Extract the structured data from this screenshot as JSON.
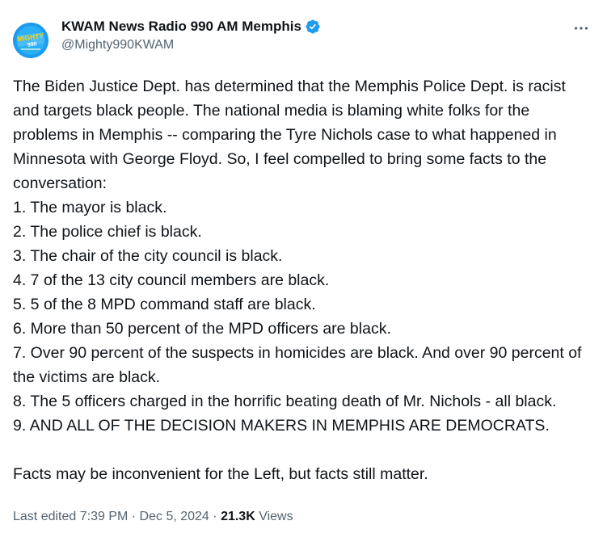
{
  "author": {
    "display_name": "KWAM News Radio 990 AM Memphis",
    "handle": "@Mighty990KWAM",
    "avatar_icon": "station-logo-icon",
    "avatar_text_top": "MIGHTY",
    "avatar_text_bottom": "990",
    "verified": true,
    "verified_color": "#1d9bf0"
  },
  "tweet": {
    "intro": "The Biden Justice Dept. has determined that the Memphis Police Dept. is racist and targets black people. The national media is blaming white folks for the problems in Memphis -- comparing the Tyre Nichols case to what happened in Minnesota with George Floyd. So, I feel compelled to bring some facts to the conversation:",
    "facts": [
      "1. The mayor is black.",
      "2. The police chief is black.",
      "3. The chair of the city council is black.",
      "4. 7 of the 13 city council members are black.",
      "5. 5 of the 8 MPD command staff are black.",
      "6. More than 50 percent of the MPD officers are black.",
      "7. Over 90 percent of the suspects in homicides are black. And over 90 percent of the victims are black.",
      "8. The 5 officers charged in the horrific beating death of Mr. Nichols - all black.",
      "9. AND ALL OF THE DECISION MAKERS IN MEMPHIS ARE DEMOCRATS."
    ],
    "closing": "Facts may be inconvenient for the Left, but facts still matter."
  },
  "meta": {
    "edited_label": "Last edited 7:39 PM",
    "separator": "·",
    "date": "Dec 5, 2024",
    "views_count": "21.3K",
    "views_label": "Views"
  },
  "colors": {
    "text_primary": "#0f1419",
    "text_secondary": "#536471",
    "accent": "#1d9bf0"
  }
}
